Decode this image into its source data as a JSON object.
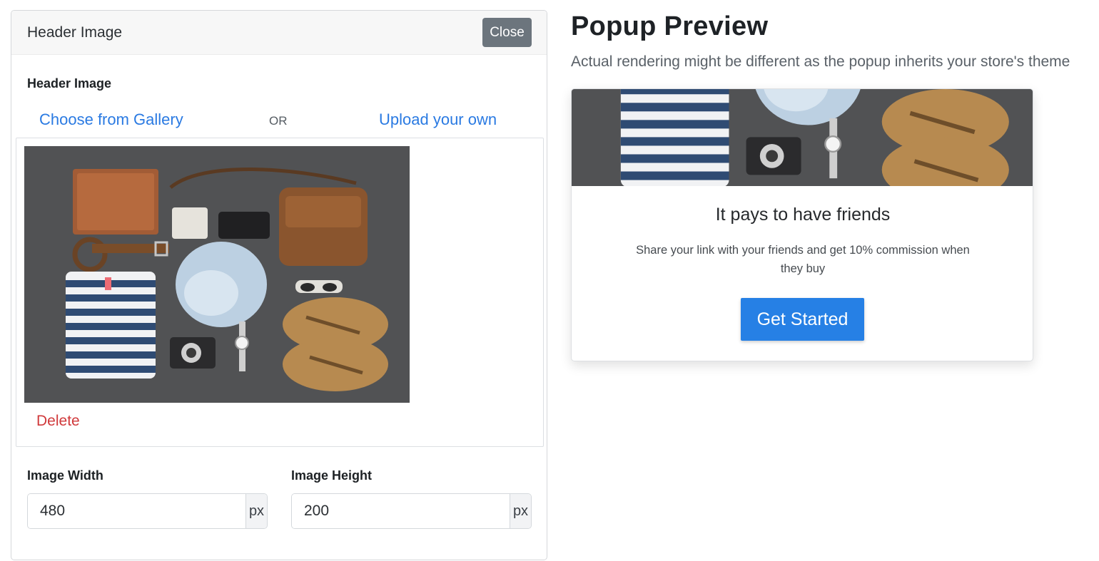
{
  "editor": {
    "title": "Header Image",
    "close_label": "Close",
    "section_label": "Header Image",
    "choose_label": "Choose from Gallery",
    "or_label": "OR",
    "upload_label": "Upload your own",
    "delete_label": "Delete",
    "width_label": "Image Width",
    "width_value": "480",
    "width_unit": "px",
    "height_label": "Image Height",
    "height_value": "200",
    "height_unit": "px"
  },
  "preview": {
    "title": "Popup Preview",
    "subtitle": "Actual rendering might be different as the popup inherits your store's theme",
    "popup": {
      "heading": "It pays to have friends",
      "text": "Share your link with your friends and get 10% commission when they buy",
      "button_label": "Get Started"
    }
  },
  "colors": {
    "link": "#2a7ae2",
    "danger": "#d0393b",
    "close_button": "#6c757d",
    "primary_button": "#2680e5"
  }
}
